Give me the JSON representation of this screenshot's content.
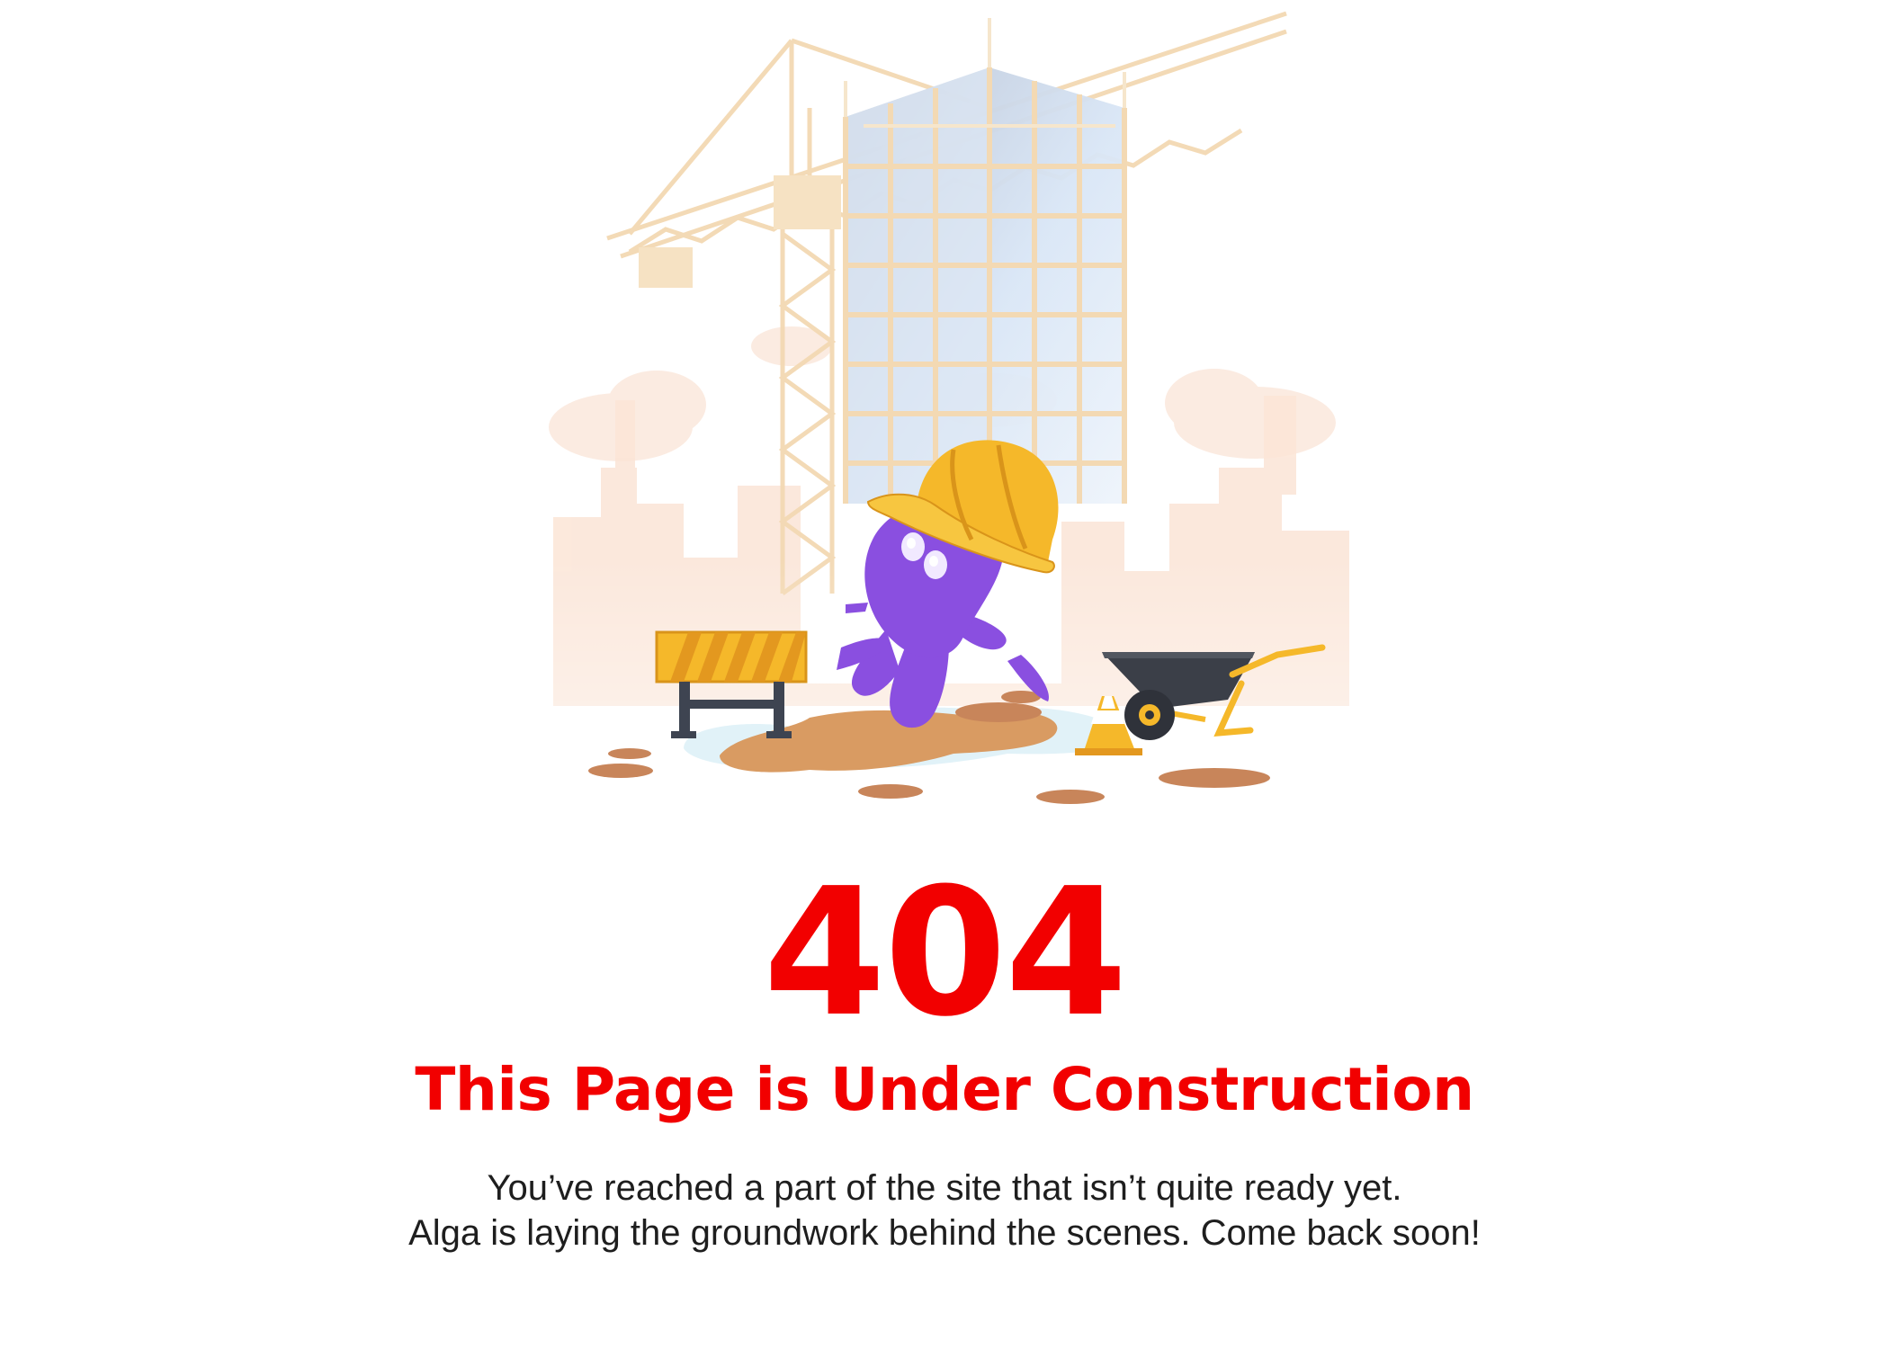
{
  "error": {
    "code": "404",
    "title": "This Page is Under Construction",
    "message_line1": "You’ve reached a part of the site that isn’t quite ready yet.",
    "message_line2": "Alga is laying the groundwork behind the scenes. Come back soon!"
  },
  "illustration": {
    "mascot_icon": "purple-octopus-mascot-with-hard-hat-icon",
    "scene": "construction-site-icon"
  },
  "colors": {
    "accent_red": "#f20000",
    "mascot_purple": "#8a4fe0",
    "helmet_yellow": "#f5b82a"
  }
}
